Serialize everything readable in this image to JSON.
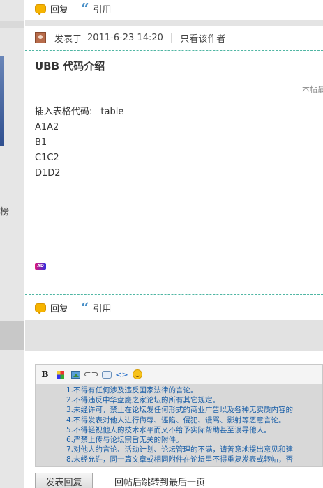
{
  "top_actions": {
    "reply_label": "回复",
    "quote_label": "引用"
  },
  "post": {
    "posted_prefix": "发表于",
    "posted_time": "2011-6-23 14:20",
    "separator": "|",
    "author_only_link": "只看该作者",
    "title": "UBB 代码介绍",
    "note": "本帖最",
    "insert_label": "插入表格代码:",
    "insert_value": "table",
    "lines": [
      "A1A2",
      "B1",
      "C1C2",
      "D1D2"
    ],
    "ad_badge": "AD"
  },
  "bottom_actions": {
    "reply_label": "回复",
    "quote_label": "引用"
  },
  "left_column": {
    "clipped_char": "榜"
  },
  "editor": {
    "toolbar_bold": "B",
    "toolbar_code": "<>",
    "rules": [
      "1.不得有任何涉及违反国家法律的言论。",
      "2.不得违反中华盘鹰之家论坛的所有其它规定。",
      "3.未经许可，禁止在论坛发任何形式的商业广告以及各种无实质内容的",
      "4.不得发表对他人进行侮辱、诬陷、侵犯、谩骂、影射等恶意言论。",
      "5.不得轻视他人的技术水平而又不给予实际帮助甚至误导他人。",
      "6.严禁上传与论坛宗旨无关的附件。",
      "7.对他人的言论、活动计划、论坛管理的不满，请善意地提出意见和建",
      "8.未经允许，同一篇文章或相同附件在论坛里不得重复发表或转帖，否"
    ]
  },
  "submit": {
    "button_label": "发表回复",
    "checkbox_label": "回帖后跳转到最后一页"
  }
}
